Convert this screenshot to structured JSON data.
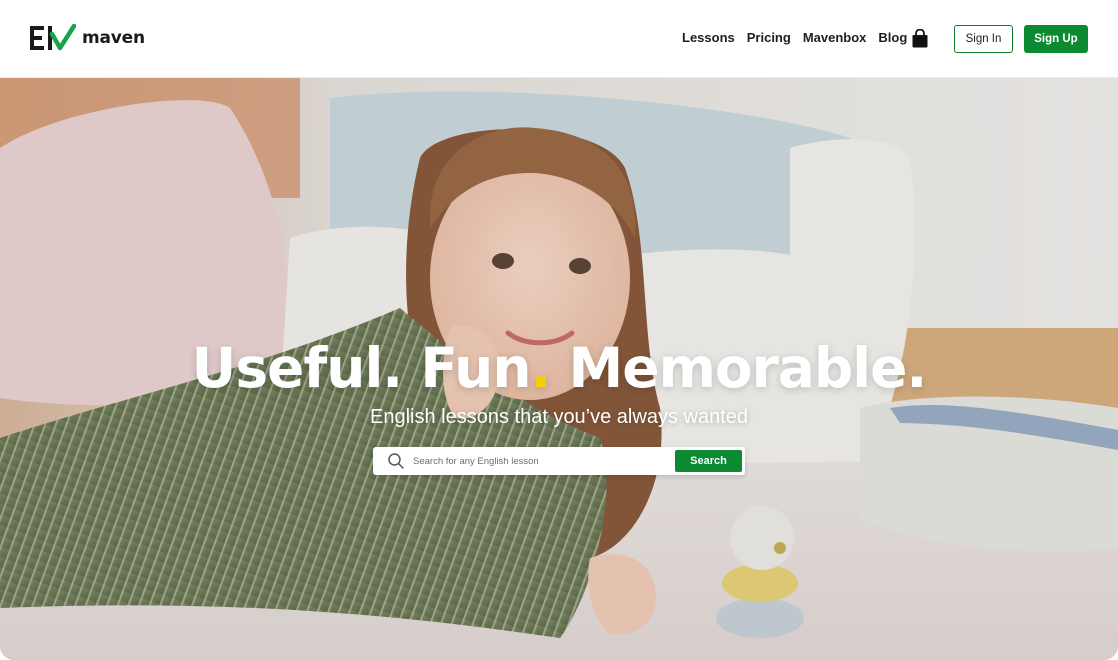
{
  "brand": {
    "name": "maven",
    "accent": "#0b8a32",
    "highlight": "#f5d000"
  },
  "nav": {
    "items": [
      {
        "label": "Lessons"
      },
      {
        "label": "Pricing"
      },
      {
        "label": "Mavenbox"
      },
      {
        "label": "Blog"
      }
    ],
    "cart_icon": "shopping-bag-icon",
    "signin_label": "Sign In",
    "signup_label": "Sign Up"
  },
  "hero": {
    "headline_part1": "Useful. Fun",
    "headline_dot": ".",
    "headline_part2": " Memorable.",
    "subheadline": "English lessons that you’ve always wanted",
    "search": {
      "placeholder": "Search for any English lesson",
      "value": "",
      "button_label": "Search",
      "icon": "search-icon"
    }
  }
}
